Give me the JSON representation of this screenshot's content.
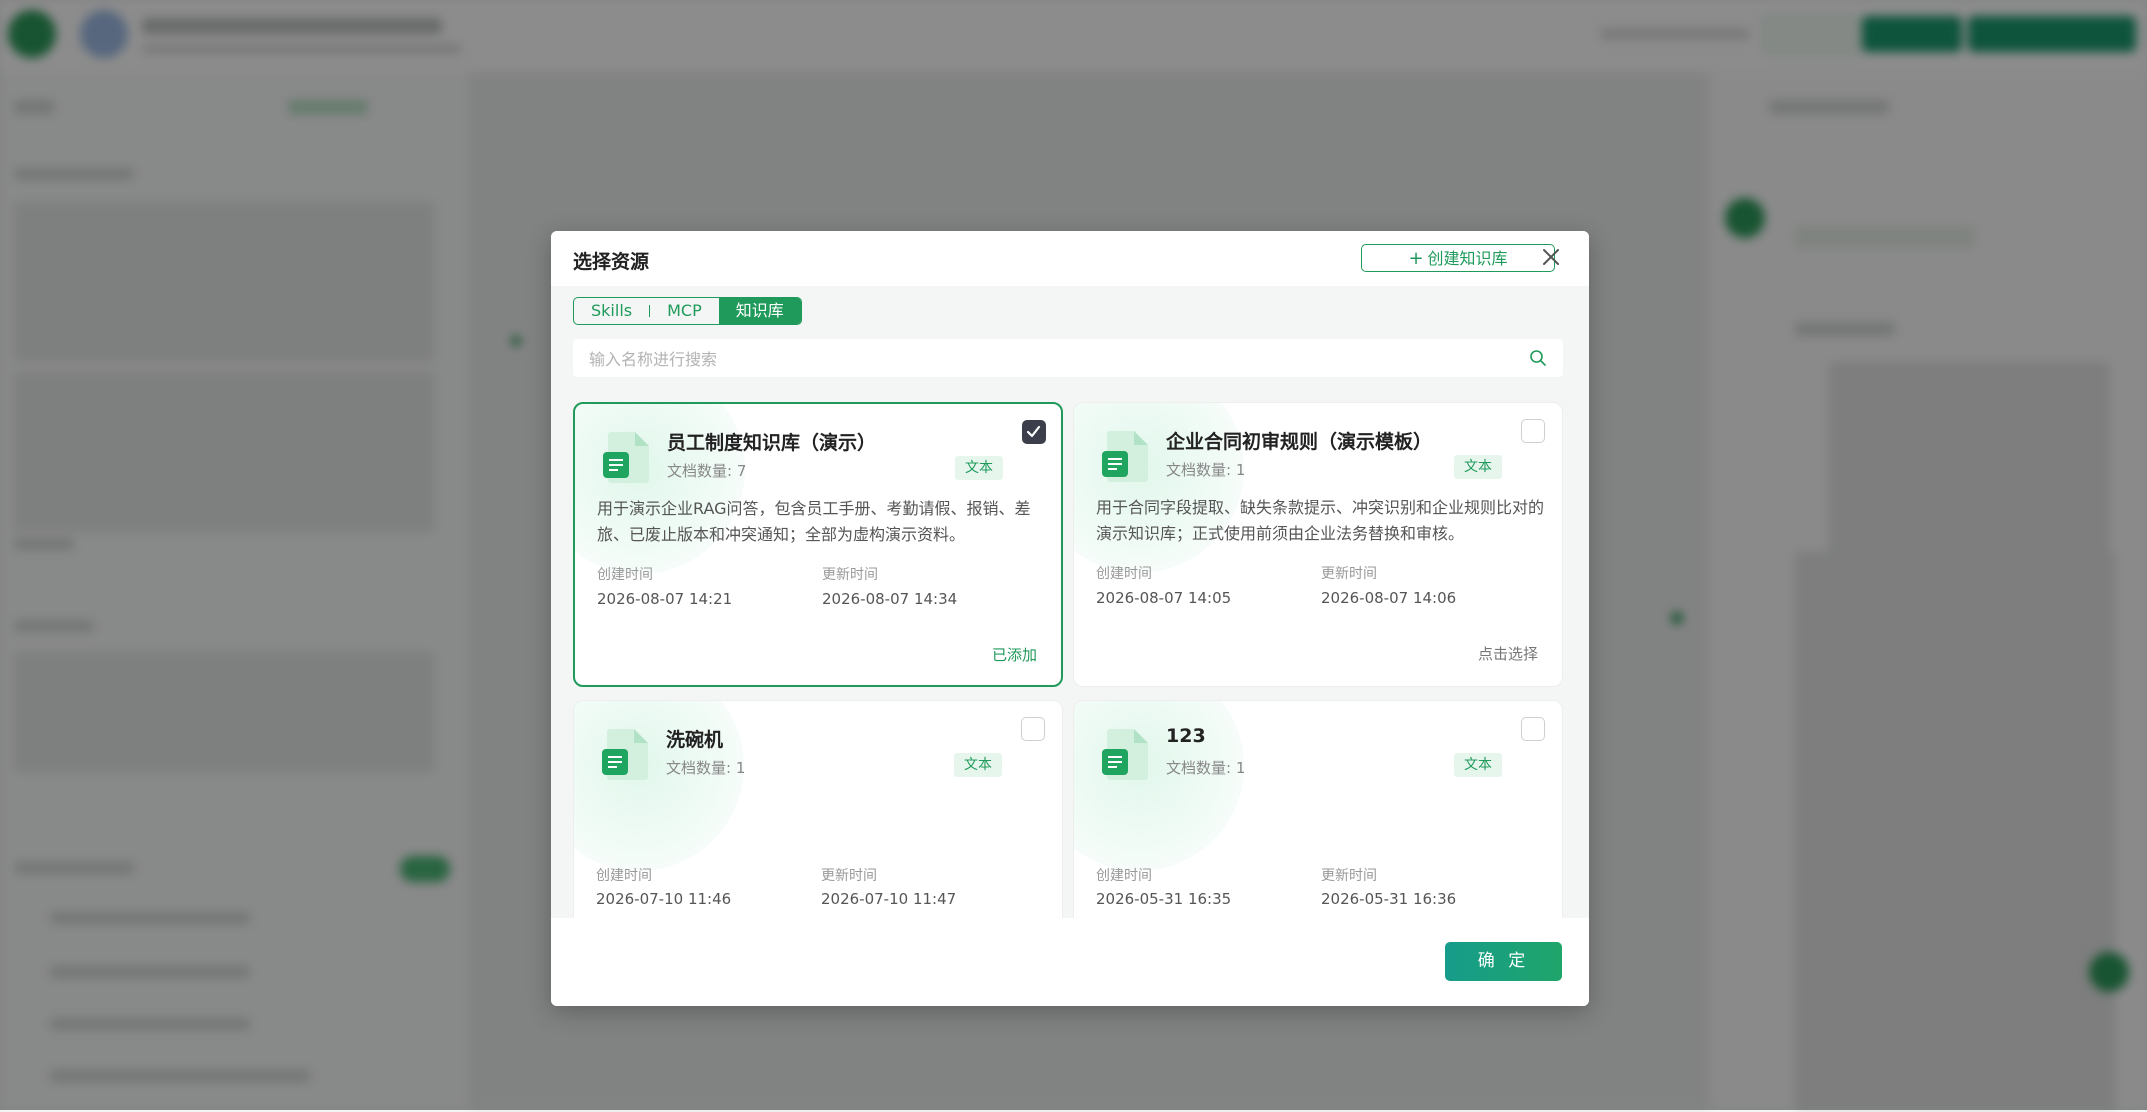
{
  "modal": {
    "title": "选择资源",
    "create_label": "创建知识库",
    "tabs": [
      {
        "label": "Skills",
        "active": false
      },
      {
        "label": "MCP",
        "active": false
      },
      {
        "label": "知识库",
        "active": true
      }
    ],
    "search_placeholder": "输入名称进行搜索",
    "confirm_label": "确 定",
    "created_label": "创建时间",
    "updated_label": "更新时间",
    "cards": [
      {
        "name": "员工制度知识库（演示）",
        "count": "文档数量: 7",
        "type": "文本",
        "selected": true,
        "description": "用于演示企业RAG问答，包含员工手册、考勤请假、报销、差旅、已废止版本和冲突通知；全部为虚构演示资料。",
        "created": "2026-08-07 14:21",
        "updated": "2026-08-07 14:34",
        "action": "已添加"
      },
      {
        "name": "企业合同初审规则（演示模板）",
        "count": "文档数量: 1",
        "type": "文本",
        "selected": false,
        "description": "用于合同字段提取、缺失条款提示、冲突识别和企业规则比对的演示知识库；正式使用前须由企业法务替换和审核。",
        "created": "2026-08-07 14:05",
        "updated": "2026-08-07 14:06",
        "action": "点击选择"
      },
      {
        "name": "洗碗机",
        "count": "文档数量: 1",
        "type": "文本",
        "selected": false,
        "description": "",
        "created": "2026-07-10 11:46",
        "updated": "2026-07-10 11:47",
        "action": ""
      },
      {
        "name": "123",
        "count": "文档数量: 1",
        "type": "文本",
        "selected": false,
        "description": "",
        "created": "2026-05-31 16:35",
        "updated": "2026-05-31 16:36",
        "action": ""
      }
    ]
  }
}
